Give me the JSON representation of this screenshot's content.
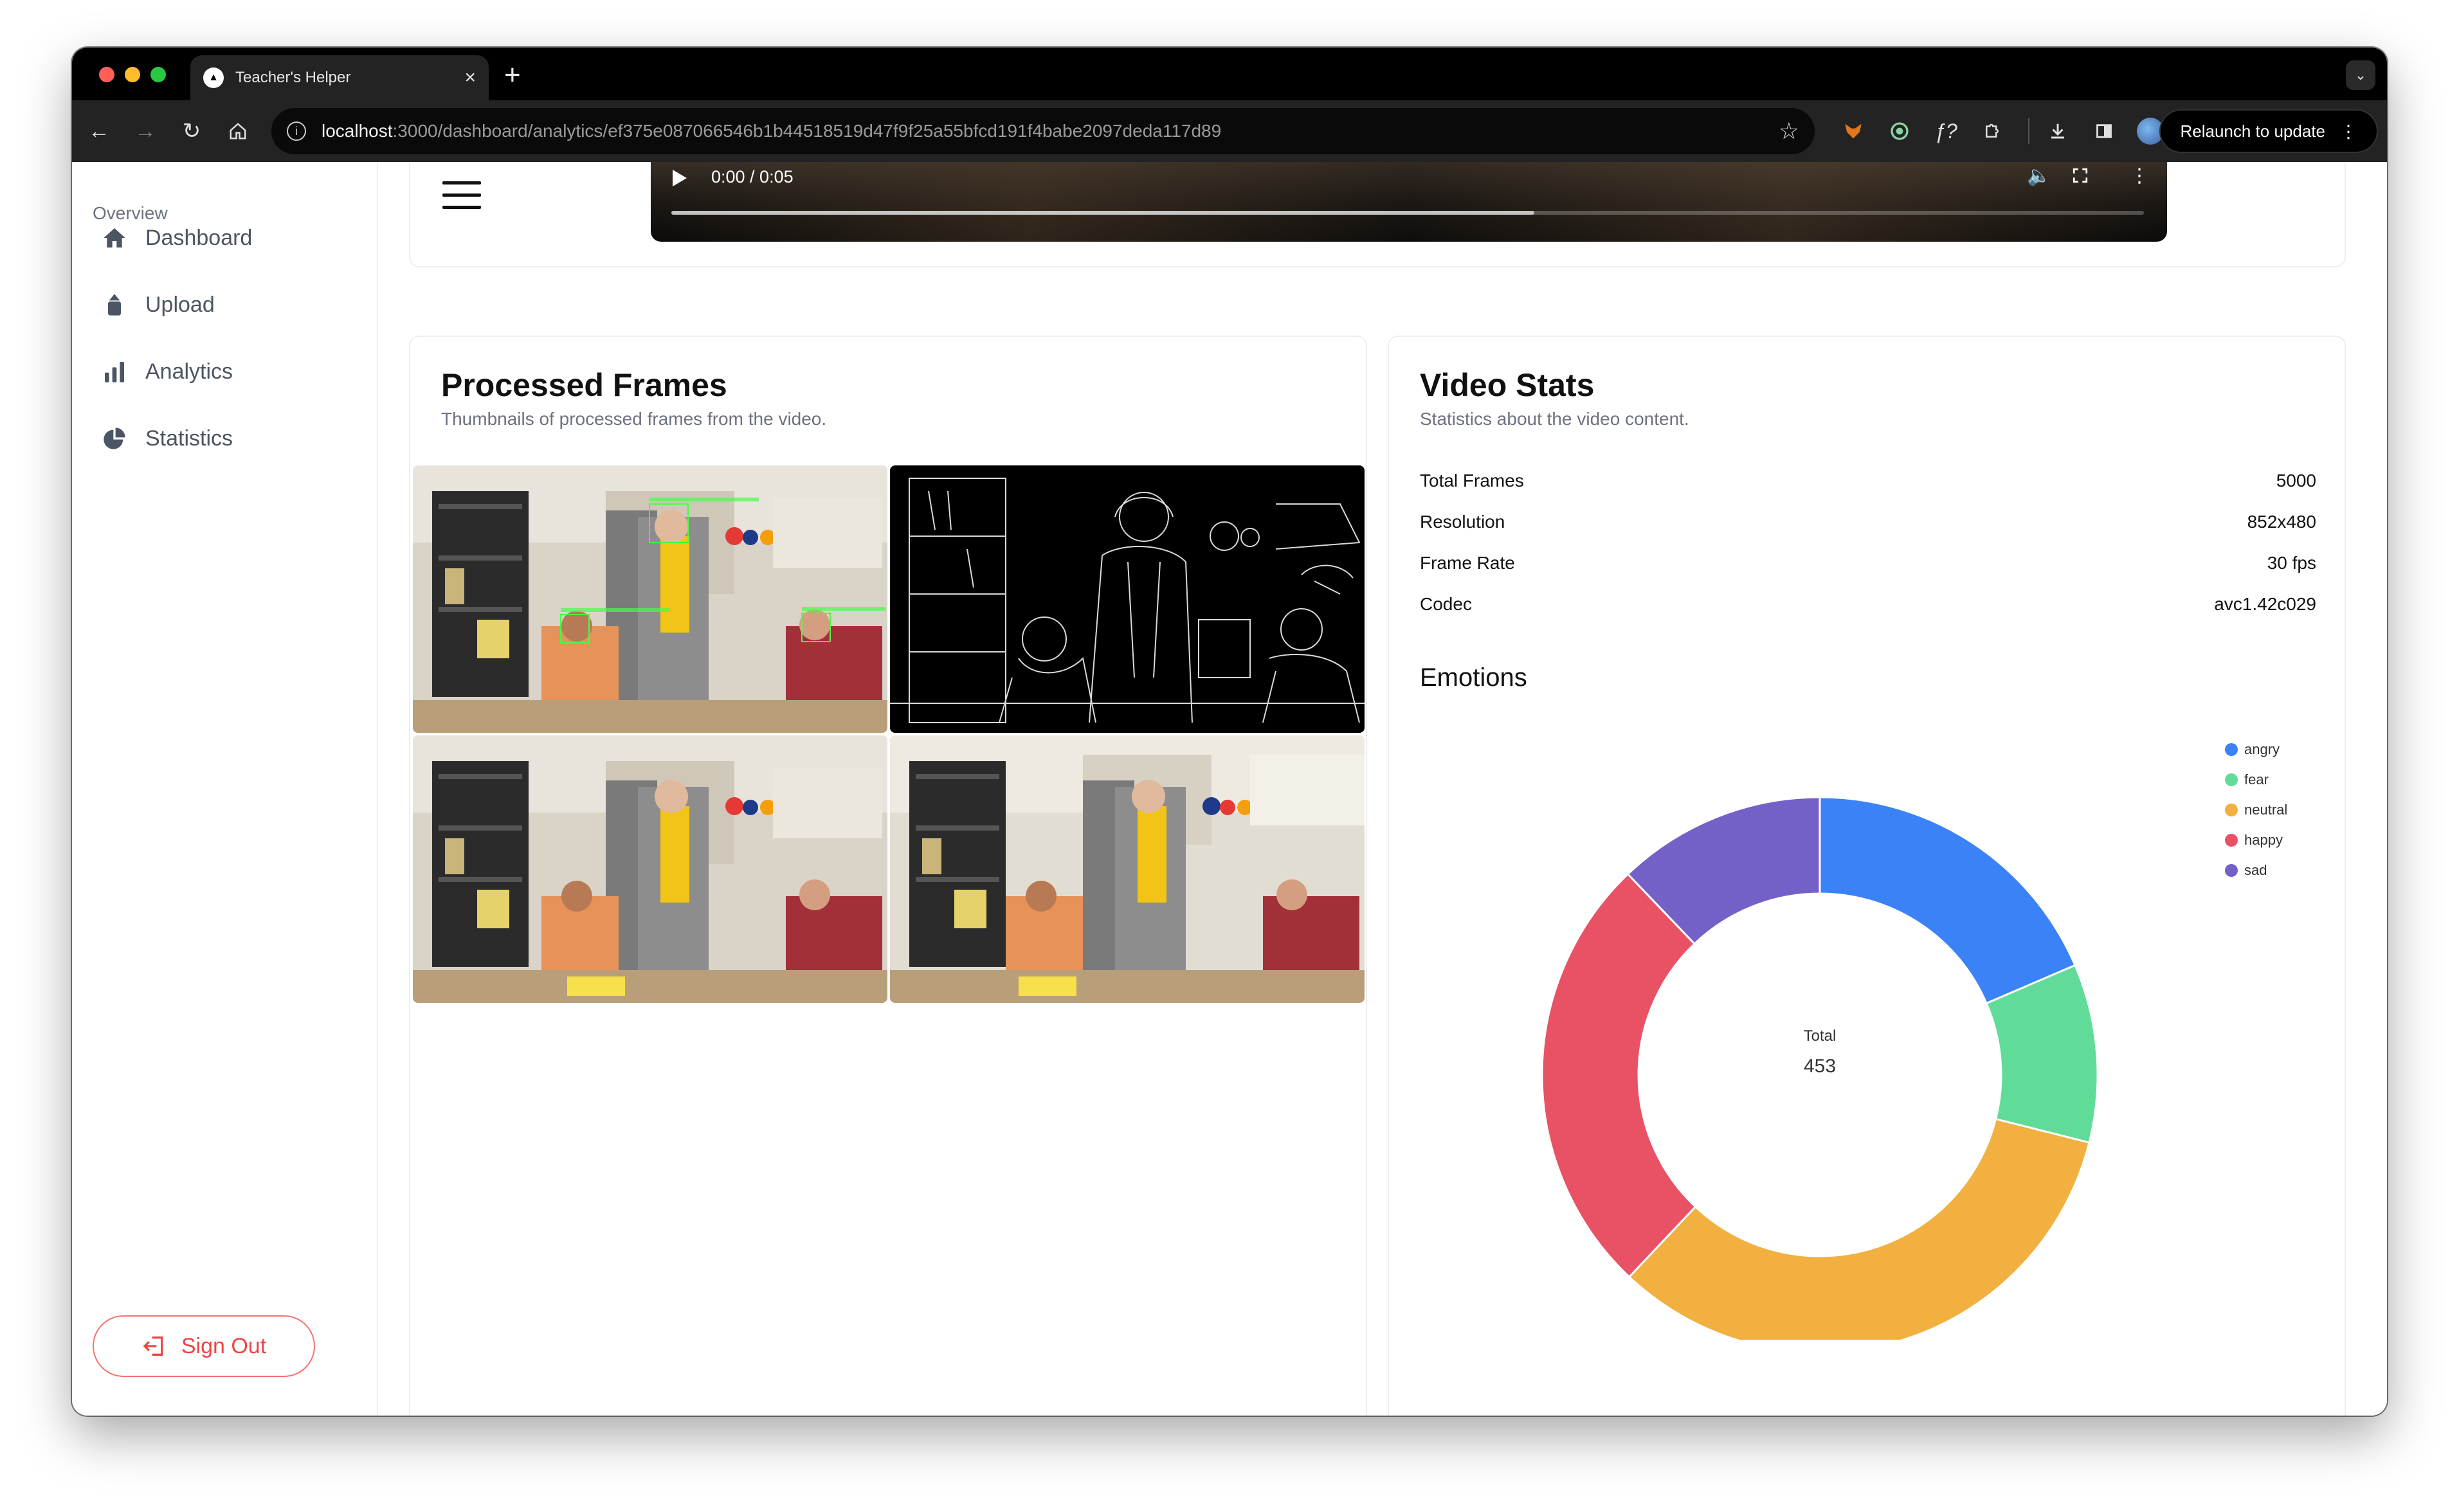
{
  "browser": {
    "tab_title": "Teacher's Helper",
    "new_tab_symbol": "+",
    "url_host": "localhost",
    "url_path": ":3000/dashboard/analytics/ef375e087066546b1b44518519d47f9f25a55bfcd191f4babe2097deda117d89",
    "relaunch_label": "Relaunch to update"
  },
  "sidebar": {
    "heading": "Overview",
    "items": [
      {
        "label": "Dashboard",
        "icon": "home-icon"
      },
      {
        "label": "Upload",
        "icon": "upload-icon"
      },
      {
        "label": "Analytics",
        "icon": "bar-chart-icon"
      },
      {
        "label": "Statistics",
        "icon": "pie-chart-icon"
      }
    ],
    "sign_out_label": "Sign Out"
  },
  "video": {
    "time": "0:00 / 0:05",
    "progress_buffered": 0.586
  },
  "frames": {
    "title": "Processed Frames",
    "subtitle": "Thumbnails of processed frames from the video."
  },
  "stats": {
    "title": "Video Stats",
    "subtitle": "Statistics about the video content.",
    "rows": [
      {
        "key": "Total Frames",
        "value": "5000"
      },
      {
        "key": "Resolution",
        "value": "852x480"
      },
      {
        "key": "Frame Rate",
        "value": "30 fps"
      },
      {
        "key": "Codec",
        "value": "avc1.42c029"
      }
    ],
    "emotions_title": "Emotions"
  },
  "chart_data": {
    "type": "pie",
    "doughnut": true,
    "center_label": "Total",
    "center_value": "453",
    "categories": [
      "angry",
      "fear",
      "neutral",
      "happy",
      "sad"
    ],
    "values": [
      84,
      47,
      150,
      117,
      55
    ],
    "colors": [
      "#3b82f6",
      "#60dc98",
      "#f2b040",
      "#e85264",
      "#7560c8"
    ],
    "legend_position": "top-right"
  },
  "colors": {
    "accent_danger": "#ef4444",
    "sidebar_text": "#4b5563"
  }
}
